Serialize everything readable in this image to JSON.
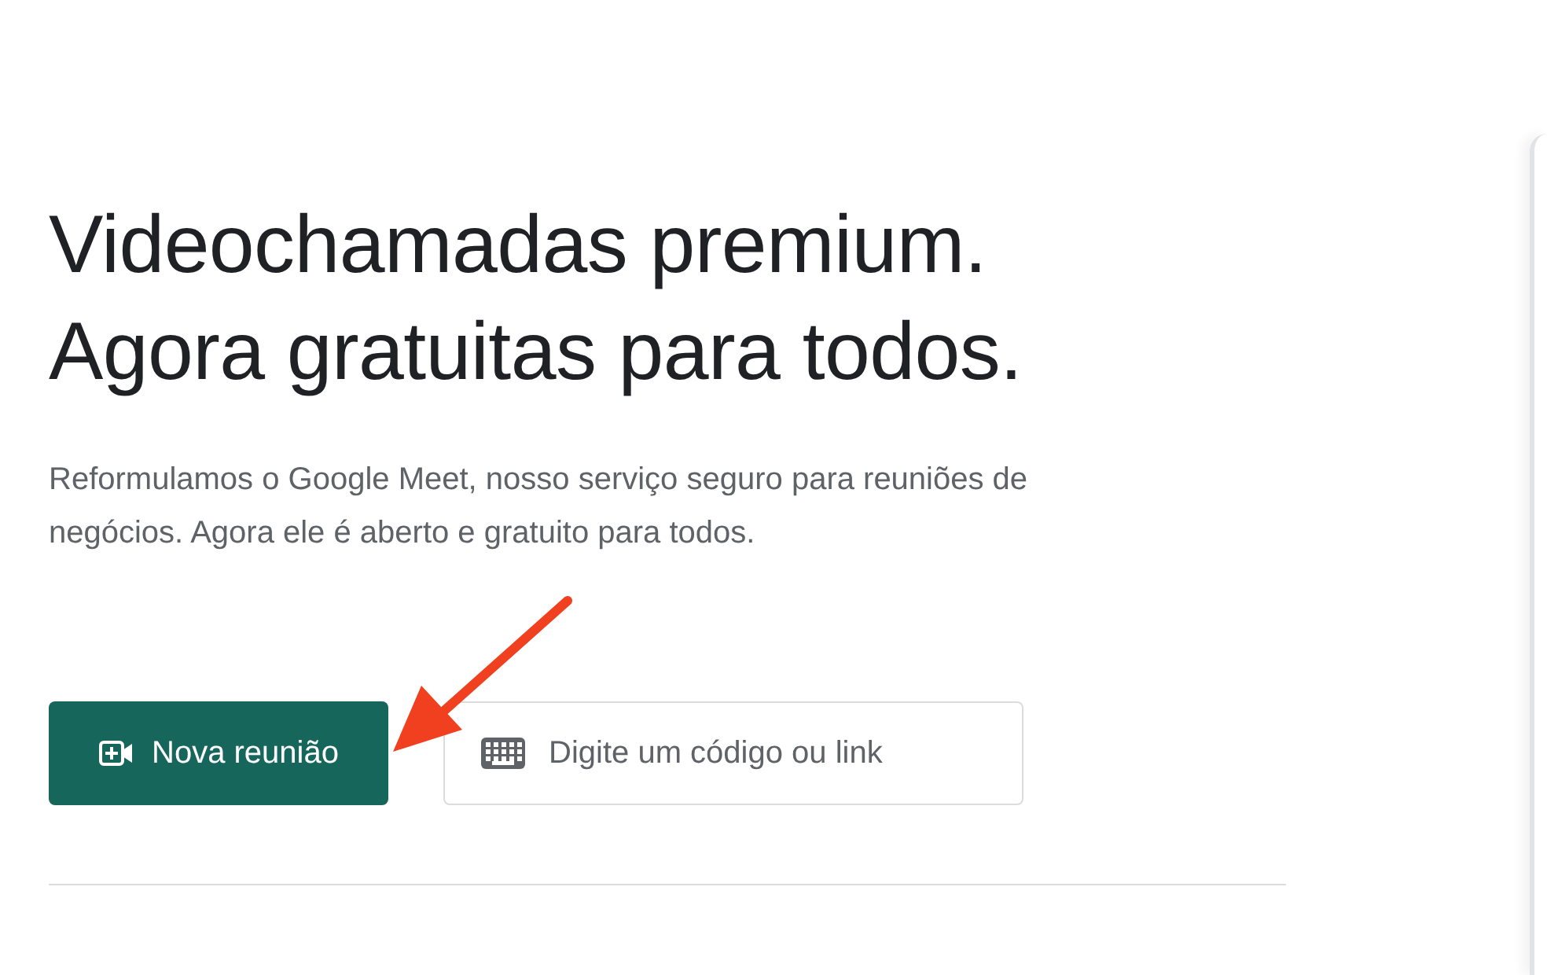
{
  "headline": [
    "Videochamadas premium.",
    "Agora gratuitas para todos."
  ],
  "description": "Reformulamos o Google Meet, nosso serviço seguro para reuniões de negócios. Agora ele é aberto e gratuito para todos.",
  "new_meeting_button": {
    "label": "Nova reunião"
  },
  "code_field": {
    "placeholder": "Digite um código ou link"
  }
}
